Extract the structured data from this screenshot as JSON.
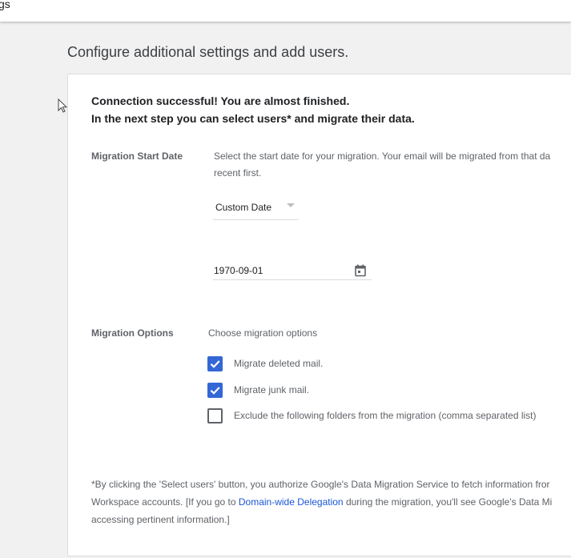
{
  "topbar": {
    "title": "gs"
  },
  "heading": "Configure additional settings and add users.",
  "intro": {
    "line1": "Connection successful! You are almost finished.",
    "line2": "In the next step you can select users* and migrate their data."
  },
  "start_date": {
    "label": "Migration Start Date",
    "desc_line1": "Select the start date for your migration. Your email will be migrated from that da",
    "desc_line2": "recent first.",
    "dropdown_value": "Custom Date",
    "date_value": "1970-09-01"
  },
  "options": {
    "label": "Migration Options",
    "desc": "Choose migration options",
    "items": [
      {
        "label": "Migrate deleted mail.",
        "checked": true
      },
      {
        "label": "Migrate junk mail.",
        "checked": true
      },
      {
        "label": "Exclude the following folders from the migration (comma separated list)",
        "checked": false
      }
    ]
  },
  "footnote": {
    "line1": "*By clicking the 'Select users' button, you authorize Google's Data Migration Service to fetch information fror",
    "line2_pre": "Workspace accounts. [If you go to ",
    "line2_link": "Domain-wide Delegation",
    "line2_post": " during the migration, you'll see Google's Data Mi",
    "line3": "accessing pertinent information.]"
  },
  "colors": {
    "accent": "#3367d6",
    "link": "#1a57d6",
    "background": "#f1f1f1"
  }
}
